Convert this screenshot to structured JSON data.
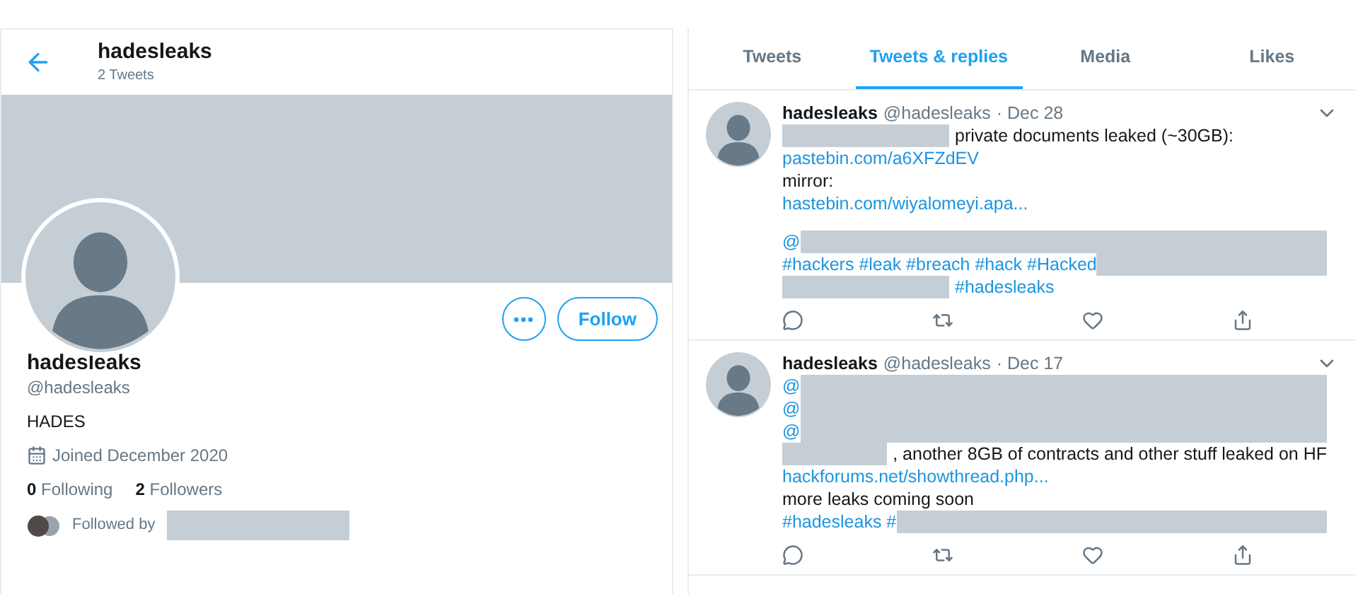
{
  "profile_header": {
    "name": "hadesleaks",
    "tweet_count": "2 Tweets"
  },
  "profile": {
    "follow_button": "Follow",
    "name": "hadesleaks",
    "handle": "@hadesleaks",
    "bio": "HADES",
    "joined": "Joined December 2020",
    "following_count": "0",
    "following_label": "Following",
    "followers_count": "2",
    "followers_label": "Followers",
    "followed_by": "Followed by"
  },
  "tabs": [
    {
      "label": "Tweets",
      "selected": false
    },
    {
      "label": "Tweets & replies",
      "selected": true
    },
    {
      "label": "Media",
      "selected": false
    },
    {
      "label": "Likes",
      "selected": false
    }
  ],
  "tweets": [
    {
      "name": "hadesleaks",
      "handle": "@hadesleaks",
      "date": "· Dec 28",
      "lines": [
        {
          "kind": "line",
          "segments": [
            {
              "kind": "redacted"
            },
            {
              "kind": "text",
              "text": "private documents leaked (~30GB):"
            }
          ]
        },
        {
          "kind": "line",
          "segments": [
            {
              "kind": "link",
              "text": "pastebin.com/a6XFZdEV"
            }
          ]
        },
        {
          "kind": "line",
          "segments": [
            {
              "kind": "text",
              "text": "mirror:"
            }
          ]
        },
        {
          "kind": "line",
          "segments": [
            {
              "kind": "link",
              "text": "hastebin.com/wiyalomeyi.apa..."
            }
          ]
        },
        {
          "kind": "blank"
        },
        {
          "kind": "line",
          "segments": [
            {
              "kind": "link",
              "text": "@"
            },
            {
              "kind": "redacted"
            }
          ]
        },
        {
          "kind": "line",
          "segments": [
            {
              "kind": "link",
              "text": "#hackers #leak #breach #hack #Hacked"
            },
            {
              "kind": "redacted"
            }
          ]
        },
        {
          "kind": "line",
          "segments": [
            {
              "kind": "redacted"
            },
            {
              "kind": "link",
              "text": "#hadesleaks"
            }
          ]
        }
      ]
    },
    {
      "name": "hadesleaks",
      "handle": "@hadesleaks",
      "date": "· Dec 17",
      "lines": [
        {
          "kind": "line",
          "segments": [
            {
              "kind": "link",
              "text": "@"
            },
            {
              "kind": "redacted"
            }
          ]
        },
        {
          "kind": "line",
          "segments": [
            {
              "kind": "link",
              "text": "@"
            },
            {
              "kind": "redacted"
            }
          ]
        },
        {
          "kind": "line",
          "segments": [
            {
              "kind": "link",
              "text": "@"
            },
            {
              "kind": "redacted"
            }
          ]
        },
        {
          "kind": "line",
          "segments": [
            {
              "kind": "redacted"
            },
            {
              "kind": "text",
              "text": ", another 8GB of contracts and other stuff leaked on HF"
            }
          ]
        },
        {
          "kind": "line",
          "segments": [
            {
              "kind": "link",
              "text": "hackforums.net/showthread.php..."
            }
          ]
        },
        {
          "kind": "line",
          "segments": [
            {
              "kind": "text",
              "text": "more leaks coming soon"
            }
          ]
        },
        {
          "kind": "line",
          "segments": [
            {
              "kind": "link",
              "text": "#hadesleaks #"
            },
            {
              "kind": "redacted"
            }
          ]
        }
      ]
    }
  ]
}
